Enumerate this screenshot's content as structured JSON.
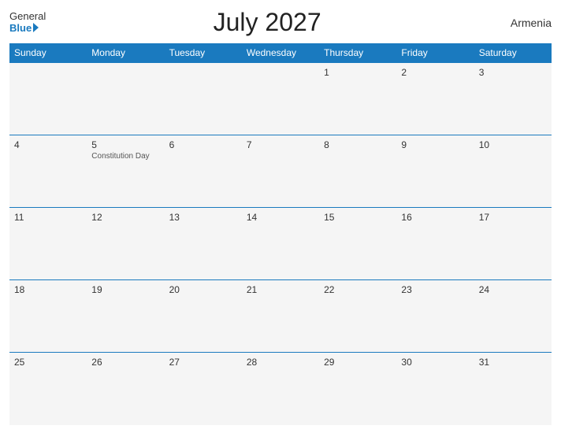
{
  "header": {
    "logo_general": "General",
    "logo_blue": "Blue",
    "title": "July 2027",
    "country": "Armenia"
  },
  "days_of_week": [
    "Sunday",
    "Monday",
    "Tuesday",
    "Wednesday",
    "Thursday",
    "Friday",
    "Saturday"
  ],
  "weeks": [
    [
      {
        "day": "",
        "holiday": ""
      },
      {
        "day": "",
        "holiday": ""
      },
      {
        "day": "",
        "holiday": ""
      },
      {
        "day": "",
        "holiday": ""
      },
      {
        "day": "1",
        "holiday": ""
      },
      {
        "day": "2",
        "holiday": ""
      },
      {
        "day": "3",
        "holiday": ""
      }
    ],
    [
      {
        "day": "4",
        "holiday": ""
      },
      {
        "day": "5",
        "holiday": "Constitution Day"
      },
      {
        "day": "6",
        "holiday": ""
      },
      {
        "day": "7",
        "holiday": ""
      },
      {
        "day": "8",
        "holiday": ""
      },
      {
        "day": "9",
        "holiday": ""
      },
      {
        "day": "10",
        "holiday": ""
      }
    ],
    [
      {
        "day": "11",
        "holiday": ""
      },
      {
        "day": "12",
        "holiday": ""
      },
      {
        "day": "13",
        "holiday": ""
      },
      {
        "day": "14",
        "holiday": ""
      },
      {
        "day": "15",
        "holiday": ""
      },
      {
        "day": "16",
        "holiday": ""
      },
      {
        "day": "17",
        "holiday": ""
      }
    ],
    [
      {
        "day": "18",
        "holiday": ""
      },
      {
        "day": "19",
        "holiday": ""
      },
      {
        "day": "20",
        "holiday": ""
      },
      {
        "day": "21",
        "holiday": ""
      },
      {
        "day": "22",
        "holiday": ""
      },
      {
        "day": "23",
        "holiday": ""
      },
      {
        "day": "24",
        "holiday": ""
      }
    ],
    [
      {
        "day": "25",
        "holiday": ""
      },
      {
        "day": "26",
        "holiday": ""
      },
      {
        "day": "27",
        "holiday": ""
      },
      {
        "day": "28",
        "holiday": ""
      },
      {
        "day": "29",
        "holiday": ""
      },
      {
        "day": "30",
        "holiday": ""
      },
      {
        "day": "31",
        "holiday": ""
      }
    ]
  ]
}
